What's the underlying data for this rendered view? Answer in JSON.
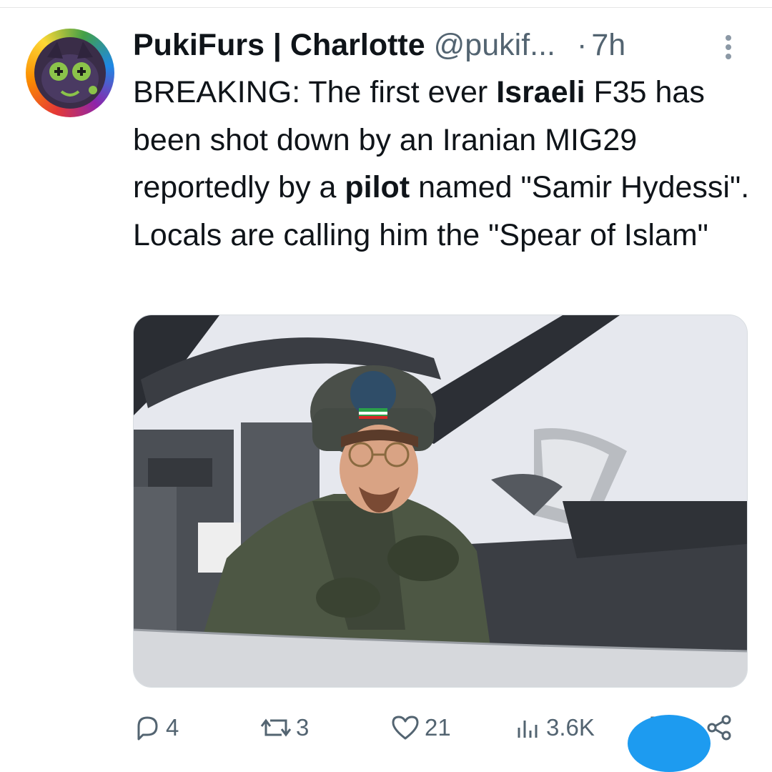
{
  "tweet": {
    "display_name": "PukiFurs | Charlotte",
    "handle": "@pukif...",
    "separator": "·",
    "time": "7h",
    "text": {
      "p1": "BREAKING: The first ever ",
      "b1": "Israeli",
      "p2": " F35 has been shot down by an Iranian MIG29 reportedly by a ",
      "b2": "pilot",
      "p3": " named \"Samir Hydessi\". Locals are calling him the \"Spear of Islam\""
    }
  },
  "actions": {
    "replies": "4",
    "reposts": "3",
    "likes": "21",
    "views": "3.6K"
  },
  "icons": {
    "reply": "reply-icon",
    "repost": "repost-icon",
    "like": "heart-icon",
    "views": "views-icon",
    "bookmark": "bookmark-icon",
    "share": "share-icon",
    "more": "more-vertical-icon"
  },
  "colors": {
    "text": "#0f1419",
    "muted": "#536471",
    "accent": "#1d9bf0"
  }
}
